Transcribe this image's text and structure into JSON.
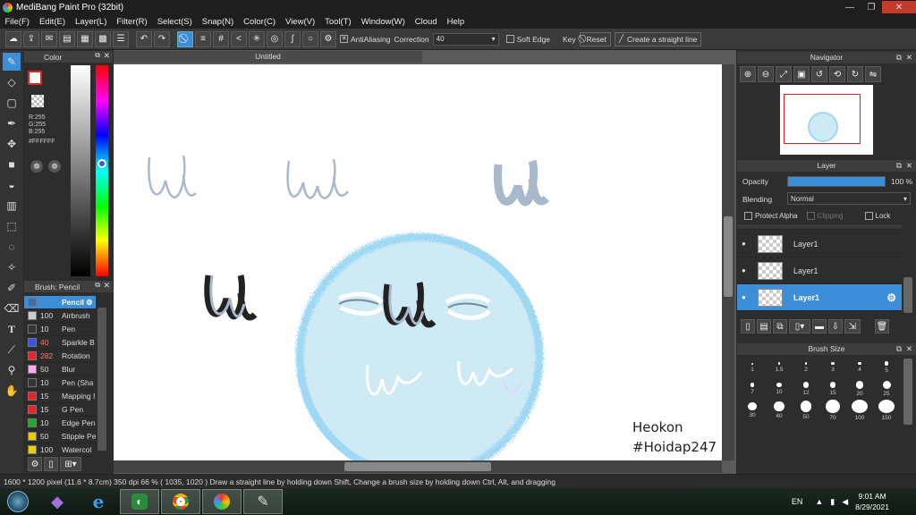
{
  "window": {
    "title": "MediBang Paint Pro (32bit)",
    "minimize": "—",
    "restore": "❐",
    "close": "✕"
  },
  "menu": [
    "File(F)",
    "Edit(E)",
    "Layer(L)",
    "Filter(R)",
    "Select(S)",
    "Snap(N)",
    "Color(C)",
    "View(V)",
    "Tool(T)",
    "Window(W)",
    "Cloud",
    "Help"
  ],
  "toolbar": {
    "antialias_label": "AntiAliasing",
    "correction_label": "Correction",
    "correction_value": "40",
    "soft_edge_label": "Soft Edge",
    "key_label": "Key",
    "reset_label": "Reset",
    "straight_line_label": "Create a straight line"
  },
  "color_panel": {
    "title": "Color",
    "r": "R:255",
    "g": "G:255",
    "b": "B:255",
    "hex": "#FFFFFF"
  },
  "brush_panel": {
    "title": "Brush: Pencil",
    "items": [
      {
        "size": "",
        "name": "Pencil",
        "color": "#3a6fb0",
        "selected": true
      },
      {
        "size": "100",
        "name": "Airbrush",
        "color": "#cccccc"
      },
      {
        "size": "10",
        "name": "Pen",
        "color": "#333333"
      },
      {
        "size": "40",
        "name": "Sparkle B",
        "color": "#3355ee"
      },
      {
        "size": "282",
        "name": "Rotation",
        "color": "#ee2222"
      },
      {
        "size": "50",
        "name": "Blur",
        "color": "#ffaaee"
      },
      {
        "size": "10",
        "name": "Pen (Sha",
        "color": "#333333"
      },
      {
        "size": "15",
        "name": "Mapping I",
        "color": "#ee2222"
      },
      {
        "size": "15",
        "name": "G Pen",
        "color": "#ee2222"
      },
      {
        "size": "10",
        "name": "Edge Pen",
        "color": "#22aa22"
      },
      {
        "size": "50",
        "name": "Stipple Pe",
        "color": "#eecc00"
      },
      {
        "size": "100",
        "name": "Watercol",
        "color": "#eecc00"
      }
    ]
  },
  "document": {
    "tab": "Untitled",
    "signature_line1": "Heokon",
    "signature_line2": "#Hoidap247"
  },
  "navigator": {
    "title": "Navigator"
  },
  "layer_panel": {
    "title": "Layer",
    "opacity_label": "Opacity",
    "opacity_value": "100 %",
    "opacity_fraction": 1.0,
    "blending_label": "Blending",
    "blending_value": "Normal",
    "protect_alpha": "Protect Alpha",
    "clipping": "Clipping",
    "lock": "Lock",
    "layers": [
      {
        "name": "Layer1",
        "active": false
      },
      {
        "name": "Layer1",
        "active": false
      },
      {
        "name": "Layer1",
        "active": true
      }
    ]
  },
  "brush_size_panel": {
    "title": "Brush Size",
    "sizes": [
      "1",
      "1.5",
      "2",
      "3",
      "4",
      "5",
      "7",
      "10",
      "12",
      "15",
      "20",
      "25",
      "30",
      "40",
      "50",
      "70",
      "100",
      "150"
    ]
  },
  "status": {
    "text": "1600 * 1200 pixel   (11.6 * 8.7cm)   350 dpi   66 %   ( 1035, 1020 )   Draw a straight line by holding down Shift, Change a brush size by holding down Ctrl, Alt, and dragging"
  },
  "taskbar": {
    "lang": "EN",
    "time": "9:01 AM",
    "date": "8/29/2021"
  }
}
